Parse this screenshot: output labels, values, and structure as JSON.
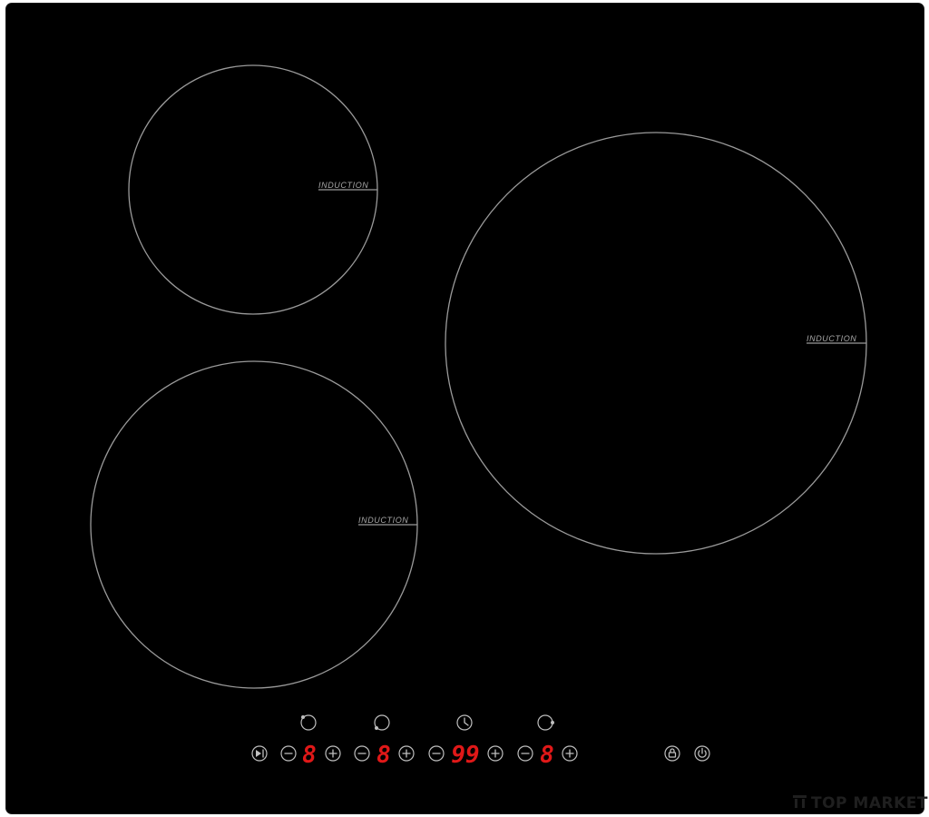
{
  "zones": [
    {
      "id": "rear-left",
      "label": "INDUCTION"
    },
    {
      "id": "right",
      "label": "INDUCTION"
    },
    {
      "id": "front-left",
      "label": "INDUCTION"
    }
  ],
  "controls": {
    "zone_indicator_icons": [
      "rear-left-zone-icon",
      "front-left-zone-icon",
      "timer-clock-icon",
      "right-zone-icon"
    ],
    "groups": [
      {
        "name": "zone-1",
        "display": "8"
      },
      {
        "name": "zone-2",
        "display": "8"
      },
      {
        "name": "timer",
        "display": "99"
      },
      {
        "name": "zone-3",
        "display": "8"
      }
    ],
    "buttons": [
      "play-pause-icon",
      "minus-icon",
      "plus-icon",
      "lock-icon",
      "power-icon"
    ]
  },
  "colors": {
    "glass": "#000000",
    "print": "#9a9a9a",
    "led": "#e01818"
  },
  "watermark": {
    "text": "TOP MARKET"
  }
}
